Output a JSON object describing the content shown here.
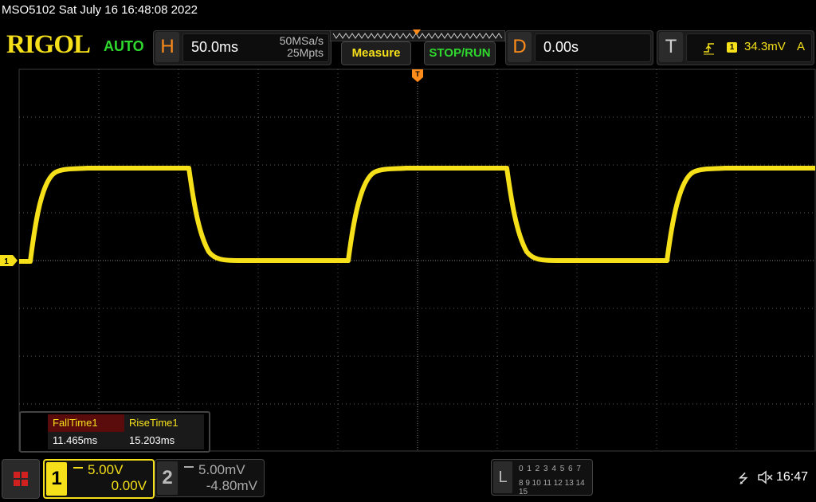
{
  "status_line": "MSO5102  Sat July 16 16:48:08 2022",
  "brand": "RIGOL",
  "trigger_mode": "AUTO",
  "horizontal": {
    "letter": "H",
    "scale": "50.0ms",
    "sample_rate": "50MSa/s",
    "memory_depth": "25Mpts"
  },
  "buttons": {
    "measure": "Measure",
    "stop_run": "STOP/RUN"
  },
  "delay": {
    "letter": "D",
    "value": "0.00s"
  },
  "trigger": {
    "letter": "T",
    "channel": "1",
    "level": "34.3mV",
    "coupling": "A"
  },
  "channel1_marker": "1",
  "measurements": {
    "fall_label": "FallTime1",
    "fall_value": "11.465ms",
    "rise_label": "RiseTime1",
    "rise_value": "15.203ms"
  },
  "channel1": {
    "number": "1",
    "scale": "5.00V",
    "offset": "0.00V"
  },
  "channel2": {
    "number": "2",
    "scale": "5.00mV",
    "offset": "-4.80mV"
  },
  "logic_analyzer": {
    "letter": "L",
    "row1": "0 1 2 3   4 5 6 7",
    "row2": "8 9 10 11 12 13 14 15"
  },
  "clock": "16:47",
  "colors": {
    "ch1": "#f5e01a",
    "accent_orange": "#ff8c1a",
    "green": "#2ed82e"
  },
  "icons": {
    "usb": "usb-icon",
    "speaker": "speaker-muted-icon",
    "menu": "menu-grid-icon",
    "trigger_edge": "rising-edge-icon"
  }
}
